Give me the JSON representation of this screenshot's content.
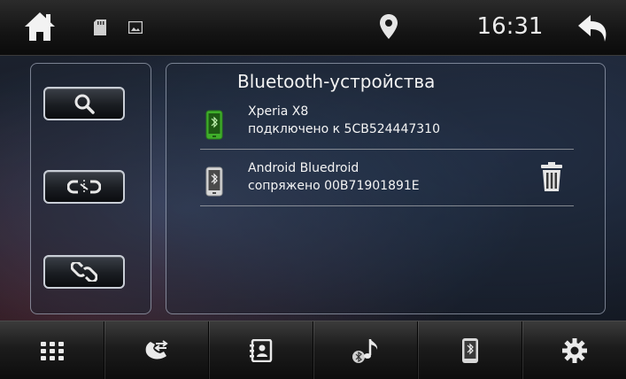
{
  "status_bar": {
    "time": "16:31",
    "icons": [
      "home-icon",
      "sd-card-icon",
      "picture-icon",
      "location-icon",
      "back-icon"
    ]
  },
  "side_buttons": [
    "search-icon",
    "pair-icon",
    "connect-icon"
  ],
  "bluetooth": {
    "title": "Bluetooth-устройства",
    "devices": [
      {
        "name": "Xperia X8",
        "status": "подключено к  5CB524447310",
        "icon": "phone-connected-icon",
        "icon_color": "#3fae2a"
      },
      {
        "name": "Android Bluedroid",
        "status": "сопряжено  00B71901891E",
        "icon": "phone-paired-icon",
        "icon_color": "#d8d8d8"
      }
    ]
  },
  "bottom_nav": [
    "apps-grid-icon",
    "call-log-icon",
    "contacts-icon",
    "bluetooth-music-icon",
    "bluetooth-phone-icon",
    "settings-gear-icon"
  ]
}
